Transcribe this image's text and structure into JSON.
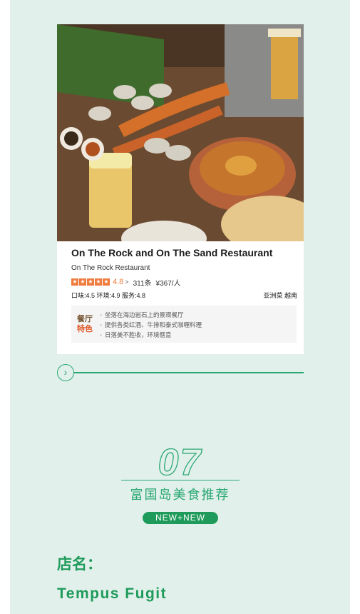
{
  "restaurant_card": {
    "title": "On The Rock and On The Sand Restaurant",
    "subtitle": "On The Rock Restaurant",
    "rating_stars": 5,
    "rating": "4.8",
    "rating_chevron": ">",
    "reviews": "311条",
    "price": "¥367/人",
    "scores": "口味:4.5 环境:4.9 服务:4.8",
    "tags": "亚洲菜 越南",
    "feature_badge_line1": "餐厅",
    "feature_badge_line2": "特色",
    "features": [
      "坐落在海边岩石上的景观餐厅",
      "提供各类红酒、牛排和泰式咖喱料理",
      "日落美不胜收，环境惬意"
    ]
  },
  "divider": {
    "icon": "chevron-right-icon"
  },
  "section": {
    "number": "07",
    "title": "富国岛美食推荐",
    "pill": "NEW+NEW"
  },
  "store": {
    "label": "店名：",
    "name": "Tempus Fugit"
  },
  "colors": {
    "panel_bg": "#e2f0ec",
    "accent_green": "#2aa872",
    "pill_green": "#1e9b5a",
    "star_orange": "#f07a3c"
  }
}
